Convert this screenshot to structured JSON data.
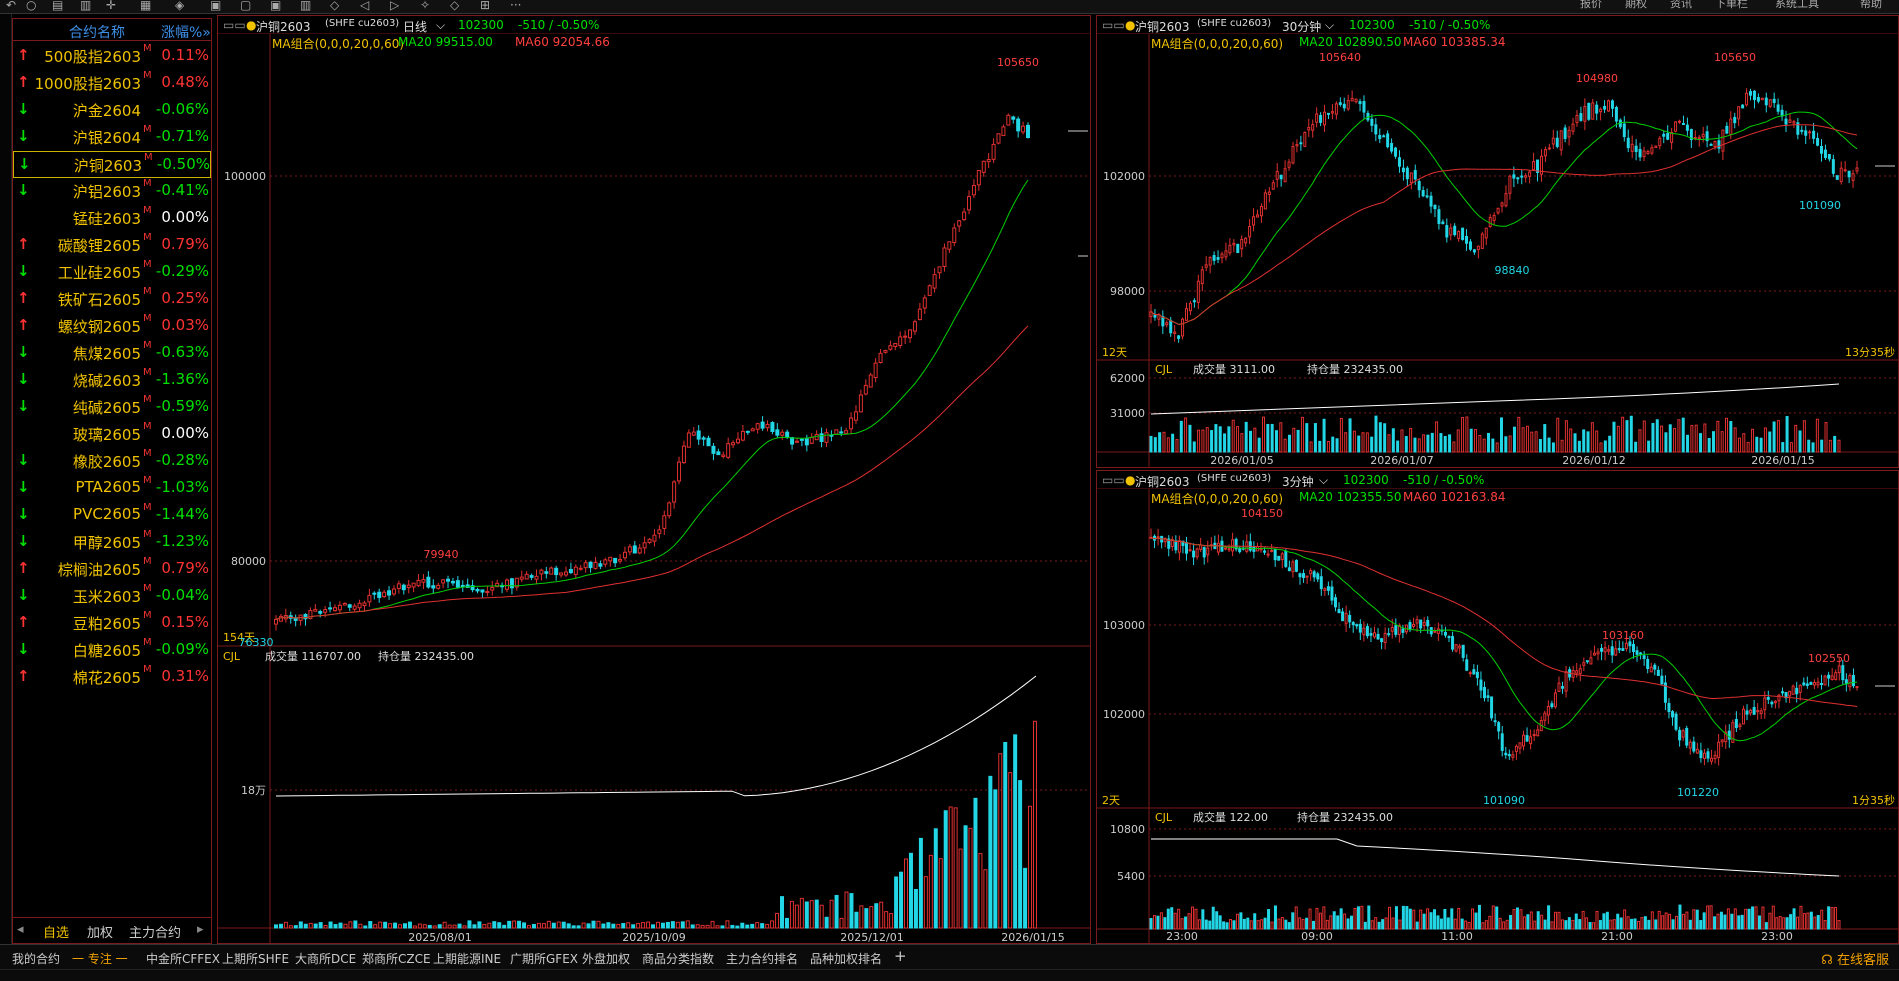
{
  "toolbar": {
    "menus": [
      "帮助",
      "系统工具",
      "下单栏",
      "资讯",
      "期权",
      "报价"
    ]
  },
  "watchlist": {
    "header_name": "合约名称",
    "header_change": "涨幅%»",
    "rows": [
      {
        "name": "500股指2603",
        "mark": "M",
        "change": "0.11%",
        "dir": "up"
      },
      {
        "name": "1000股指2603",
        "mark": "M",
        "change": "0.48%",
        "dir": "up"
      },
      {
        "name": "沪金2604",
        "mark": "",
        "change": "-0.06%",
        "dir": "down"
      },
      {
        "name": "沪银2604",
        "mark": "M",
        "change": "-0.71%",
        "dir": "down"
      },
      {
        "name": "沪铜2603",
        "mark": "M",
        "change": "-0.50%",
        "dir": "down",
        "selected": true
      },
      {
        "name": "沪铝2603",
        "mark": "M",
        "change": "-0.41%",
        "dir": "down"
      },
      {
        "name": "锰硅2603",
        "mark": "M",
        "change": "0.00%",
        "dir": "flat"
      },
      {
        "name": "碳酸锂2605",
        "mark": "M",
        "change": "0.79%",
        "dir": "up"
      },
      {
        "name": "工业硅2605",
        "mark": "M",
        "change": "-0.29%",
        "dir": "down"
      },
      {
        "name": "铁矿石2605",
        "mark": "M",
        "change": "0.25%",
        "dir": "up"
      },
      {
        "name": "螺纹钢2605",
        "mark": "M",
        "change": "0.03%",
        "dir": "up"
      },
      {
        "name": "焦煤2605",
        "mark": "M",
        "change": "-0.63%",
        "dir": "down"
      },
      {
        "name": "烧碱2603",
        "mark": "M",
        "change": "-1.36%",
        "dir": "down"
      },
      {
        "name": "纯碱2605",
        "mark": "M",
        "change": "-0.59%",
        "dir": "down"
      },
      {
        "name": "玻璃2605",
        "mark": "M",
        "change": "0.00%",
        "dir": "flat"
      },
      {
        "name": "橡胶2605",
        "mark": "M",
        "change": "-0.28%",
        "dir": "down"
      },
      {
        "name": "PTA2605",
        "mark": "M",
        "change": "-1.03%",
        "dir": "down"
      },
      {
        "name": "PVC2605",
        "mark": "M",
        "change": "-1.44%",
        "dir": "down"
      },
      {
        "name": "甲醇2605",
        "mark": "M",
        "change": "-1.23%",
        "dir": "down"
      },
      {
        "name": "棕榈油2605",
        "mark": "M",
        "change": "0.79%",
        "dir": "up"
      },
      {
        "name": "玉米2603",
        "mark": "M",
        "change": "-0.04%",
        "dir": "down"
      },
      {
        "name": "豆粕2605",
        "mark": "M",
        "change": "0.15%",
        "dir": "up"
      },
      {
        "name": "白糖2605",
        "mark": "M",
        "change": "-0.09%",
        "dir": "down"
      },
      {
        "name": "棉花2605",
        "mark": "M",
        "change": "0.31%",
        "dir": "up"
      }
    ],
    "tabs": [
      "自选",
      "加权",
      "主力合约"
    ]
  },
  "charts": {
    "daily": {
      "symbol": "沪铜2603",
      "exchange": "(SHFE cu2603)",
      "period": "日线",
      "price": "102300",
      "change": "-510 / -0.50%",
      "ma_combo": "MA组合(0,0,0,20,0,60)",
      "ma20": "MA20 99515.00",
      "ma60": "MA60 92054.66",
      "vol_label": "CJL",
      "vol_value": "成交量 116707.00",
      "oi_value": "持仓量 232435.00",
      "bars_label": "154天",
      "y_ticks": [
        "100000",
        "80000"
      ],
      "vol_ticks": [
        "18万"
      ],
      "x_ticks": [
        "2025/08/01",
        "2025/10/09",
        "2025/12/01",
        "2026/01/15"
      ],
      "annotations": {
        "high": "105650",
        "mid": "79940",
        "low": "76330"
      }
    },
    "min30": {
      "symbol": "沪铜2603",
      "exchange": "(SHFE cu2603)",
      "period": "30分钟",
      "price": "102300",
      "change": "-510 / -0.50%",
      "ma_combo": "MA组合(0,0,0,20,0,60)",
      "ma20": "MA20 102890.50",
      "ma60": "MA60 103385.34",
      "vol_label": "CJL",
      "vol_value": "成交量 3111.00",
      "oi_value": "持仓量 232435.00",
      "bars_label": "12天",
      "countdown": "13分35秒",
      "y_ticks": [
        "102000",
        "98000"
      ],
      "vol_ticks": [
        "62000",
        "31000"
      ],
      "x_ticks": [
        "2026/01/05",
        "2026/01/07",
        "2026/01/12",
        "2026/01/15"
      ],
      "annotations": {
        "h1": "105640",
        "h2": "104980",
        "h3": "105650",
        "l1": "98840",
        "l2": "101090"
      }
    },
    "min3": {
      "symbol": "沪铜2603",
      "exchange": "(SHFE cu2603)",
      "period": "3分钟",
      "price": "102300",
      "change": "-510 / -0.50%",
      "ma_combo": "MA组合(0,0,0,20,0,60)",
      "ma20": "MA20 102355.50",
      "ma60": "MA60 102163.84",
      "vol_label": "CJL",
      "vol_value": "成交量 122.00",
      "oi_value": "持仓量 232435.00",
      "bars_label": "2天",
      "countdown": "1分35秒",
      "y_ticks": [
        "103000",
        "102000"
      ],
      "vol_ticks": [
        "10800",
        "5400"
      ],
      "x_ticks": [
        "23:00",
        "09:00",
        "11:00",
        "21:00",
        "23:00"
      ],
      "annotations": {
        "h1": "104150",
        "h2": "103160",
        "h3": "102550",
        "l1": "101090",
        "l2": "101220"
      }
    }
  },
  "bottom_tabs": [
    "我的合约",
    "一 专注 一",
    "中金所CFFEX",
    "上期所SHFE",
    "大商所DCE",
    "郑商所CZCE",
    "上期能源INE",
    "广期所GFEX",
    "外盘加权",
    "商品分类指数",
    "主力合约排名",
    "品种加权排名",
    "+"
  ],
  "status": {
    "online": "在线客服"
  },
  "colors": {
    "up": "#ff3333",
    "down": "#00e000",
    "candle_up": "#e03030",
    "candle_down": "#22d6e6",
    "ma20": "#00d000",
    "ma60": "#e03030",
    "accent": "#f0c200"
  }
}
